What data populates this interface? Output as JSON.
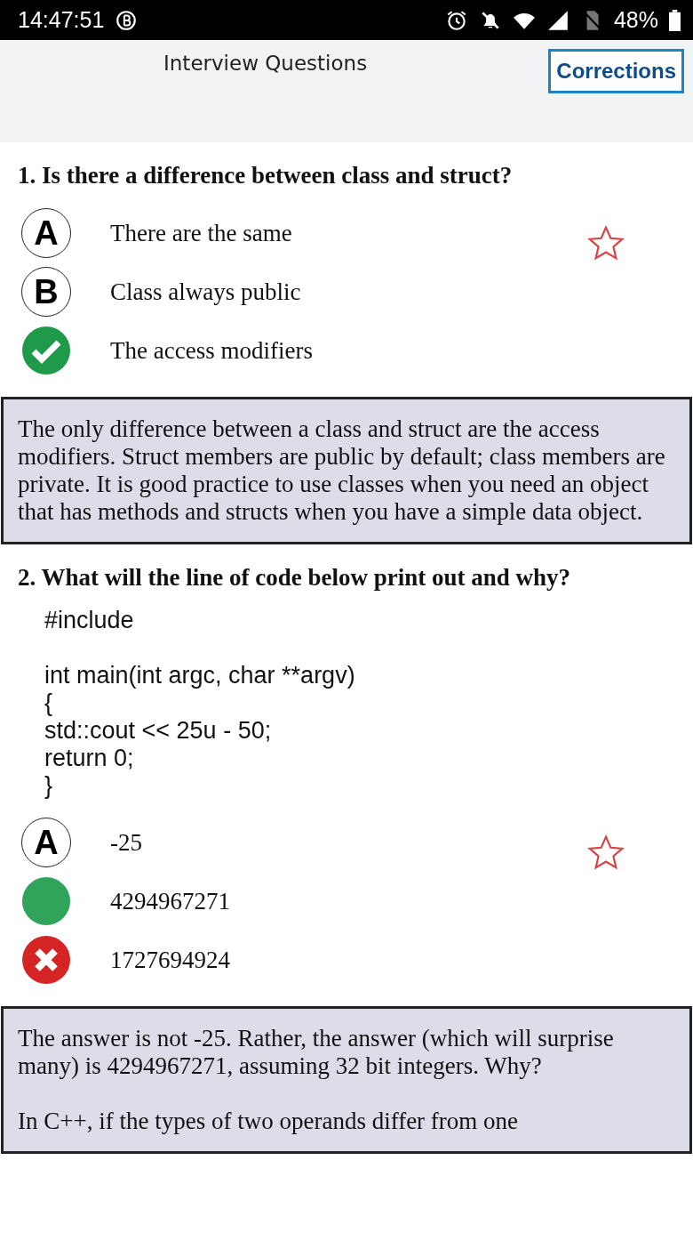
{
  "status_bar": {
    "time": "14:47:51",
    "battery": "48%"
  },
  "header": {
    "title": "Interview Questions",
    "button": "Corrections"
  },
  "questions": [
    {
      "number": "1.",
      "text": "Is there a difference between class and struct?",
      "starred": false,
      "options": [
        {
          "kind": "letter",
          "letter": "A",
          "text": "There are the same"
        },
        {
          "kind": "letter",
          "letter": "B",
          "text": "Class always public"
        },
        {
          "kind": "correct",
          "text": "The access modifiers"
        }
      ],
      "explanation": [
        "The only difference between a class and struct are the access modifiers. Struct members are public by default; class members are private. It is good practice to use classes when you need an object that has methods and structs when you have a simple data object."
      ]
    },
    {
      "number": "2.",
      "text": "What will the line of code below print out and why?",
      "starred": false,
      "code_blocks": [
        [
          "#include"
        ],
        [
          "int main(int argc, char **argv)",
          "{",
          "std::cout << 25u - 50;",
          "return 0;",
          "}"
        ]
      ],
      "options": [
        {
          "kind": "letter",
          "letter": "A",
          "text": "-25"
        },
        {
          "kind": "answer",
          "text": "4294967271"
        },
        {
          "kind": "wrong",
          "text": "1727694924"
        }
      ],
      "explanation": [
        "The answer is not -25. Rather, the answer (which will surprise many) is 4294967271, assuming 32 bit integers. Why?",
        "In C++, if the types of two operands differ from one"
      ]
    }
  ]
}
